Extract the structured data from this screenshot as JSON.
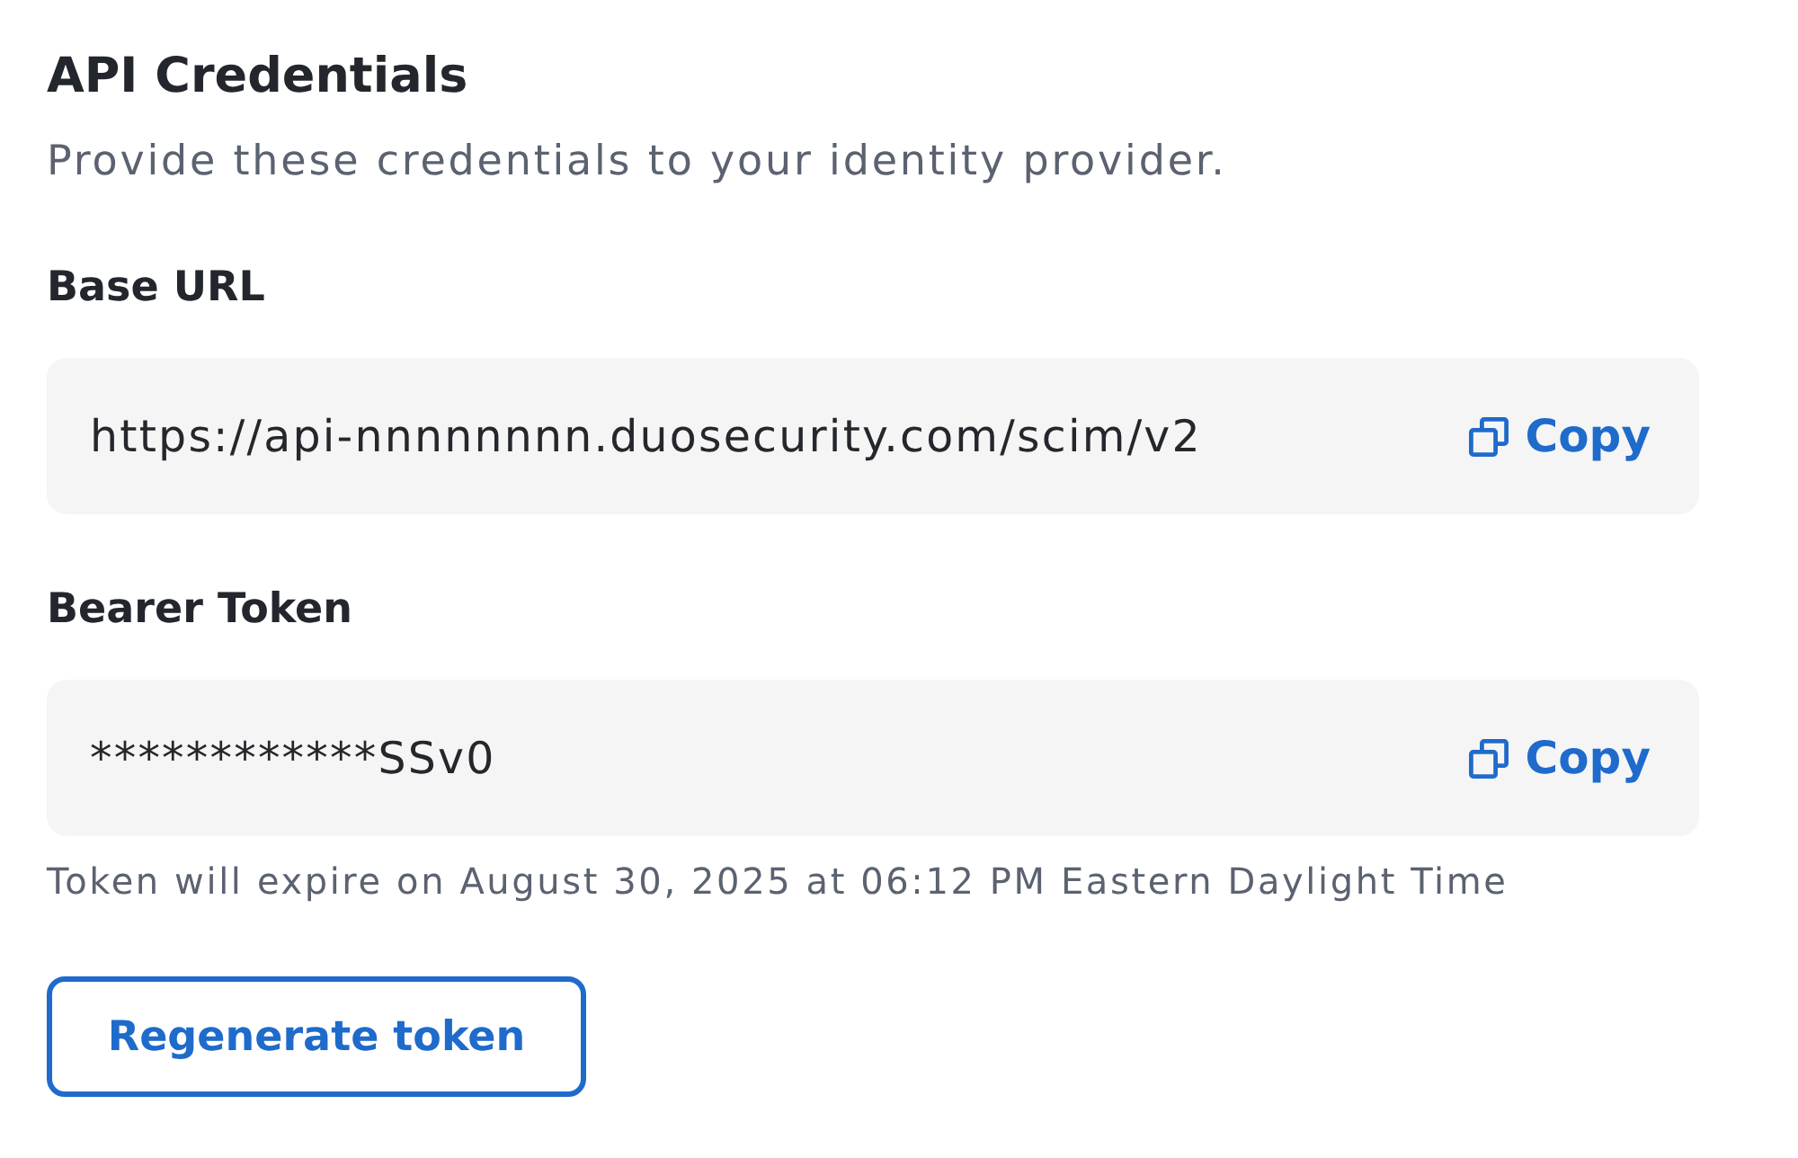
{
  "section": {
    "title": "API Credentials",
    "description": "Provide these credentials to your identity provider."
  },
  "fields": [
    {
      "label": "Base URL",
      "value": "https://api-nnnnnnnn.duosecurity.com/scim/v2",
      "action": "Copy"
    },
    {
      "label": "Bearer Token",
      "value": "************SSv0",
      "action": "Copy",
      "note": "Token will expire on August 30, 2025 at 06:12 PM Eastern Daylight Time"
    }
  ],
  "button": {
    "label": "Regenerate token"
  }
}
